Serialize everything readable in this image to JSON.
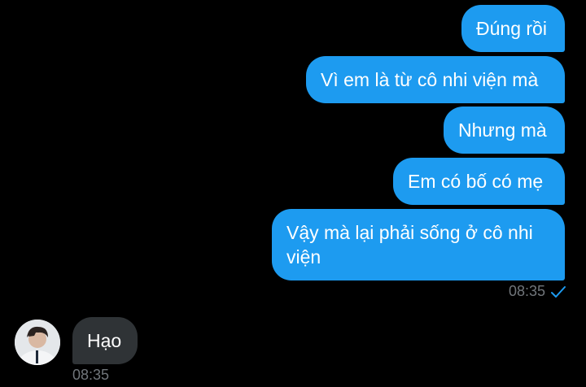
{
  "conversation": {
    "outgoing": [
      {
        "text": "Đúng rồi"
      },
      {
        "text": "Vì em là từ cô nhi viện mà"
      },
      {
        "text": "Nhưng mà"
      },
      {
        "text": "Em có bố có mẹ"
      },
      {
        "text": "Vậy mà lại phải sống ở cô nhi viện"
      }
    ],
    "outgoing_time": "08:35",
    "incoming": {
      "text": "Hạo",
      "time": "08:35"
    }
  },
  "colors": {
    "background": "#000000",
    "outgoing_bubble": "#1d9bf0",
    "incoming_bubble": "#2f3336",
    "timestamp": "#71767b",
    "read_check": "#1d9bf0"
  },
  "icons": {
    "read_receipt": "check-icon",
    "avatar": "avatar"
  }
}
